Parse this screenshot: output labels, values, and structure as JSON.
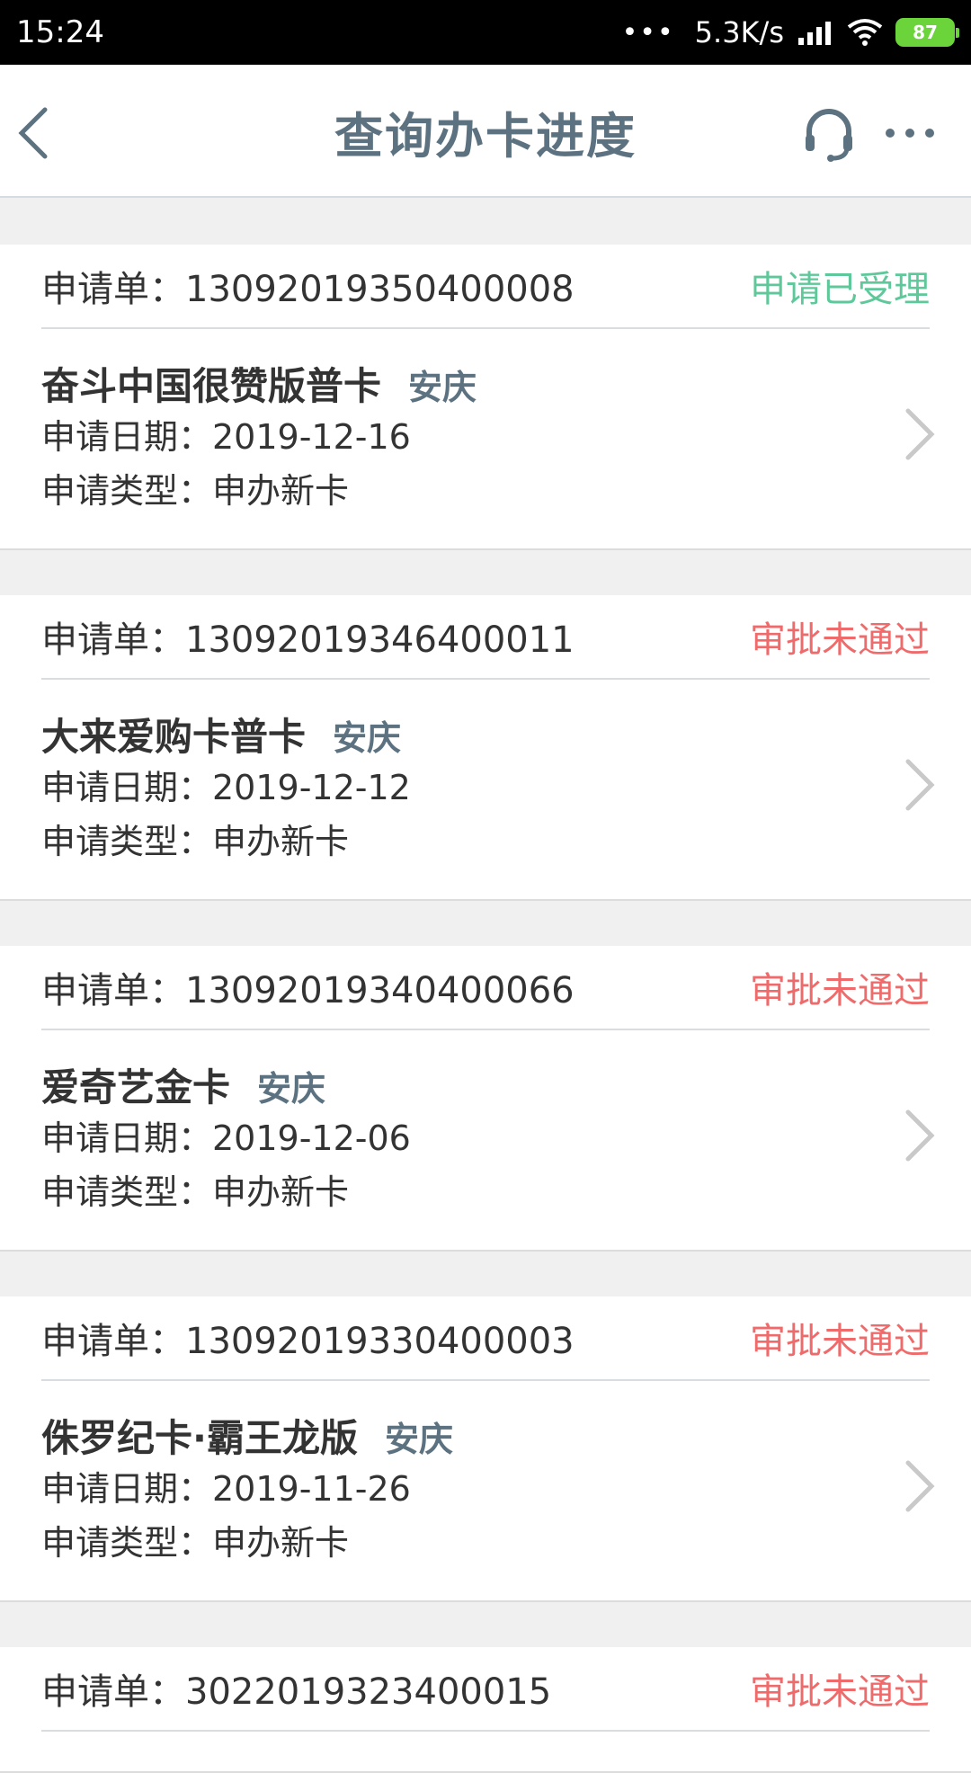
{
  "statusbar": {
    "time": "15:24",
    "dots": "•••",
    "net_speed": "5.3K/s",
    "battery": "87",
    "battery_color": "#6ad43a"
  },
  "navbar": {
    "title": "查询办卡进度",
    "icons": [
      "back-icon",
      "headset-icon",
      "more-icon"
    ]
  },
  "colors": {
    "accepted": "#5fc89a",
    "rejected": "#ef6b6b",
    "city": "#5d7280"
  },
  "applications": [
    {
      "order_label": "申请单：1309201935040000 8",
      "status": "申请已受理",
      "card_name": "奋斗中国很赞版普卡",
      "city": "安庆",
      "date_line": "申请日期：2019-12-16",
      "type_line": "申请类型：申办新卡"
    },
    {
      "order_label": "申请单：1309201934640001 1",
      "status": "审批未通过",
      "card_name": "大来爱购卡普卡",
      "city": "安庆",
      "date_line": "申请日期：2019-12-12",
      "type_line": "申请类型：申办新卡"
    },
    {
      "order_label": "申请单：1309201934040006 6",
      "status": "审批未通过",
      "card_name": "爱奇艺金卡",
      "city": "安庆",
      "date_line": "申请日期：2019-12-06",
      "type_line": "申请类型：申办新卡"
    },
    {
      "order_label": "申请单：1309201933040000 3",
      "status": "审批未通过",
      "card_name": "侏罗纪卡·霸王龙版",
      "city": "安庆",
      "date_line": "申请日期：2019-11-26",
      "type_line": "申请类型：申办新卡"
    },
    {
      "order_label": "申请单：302201932340001 5",
      "status": "审批未通过"
    }
  ]
}
